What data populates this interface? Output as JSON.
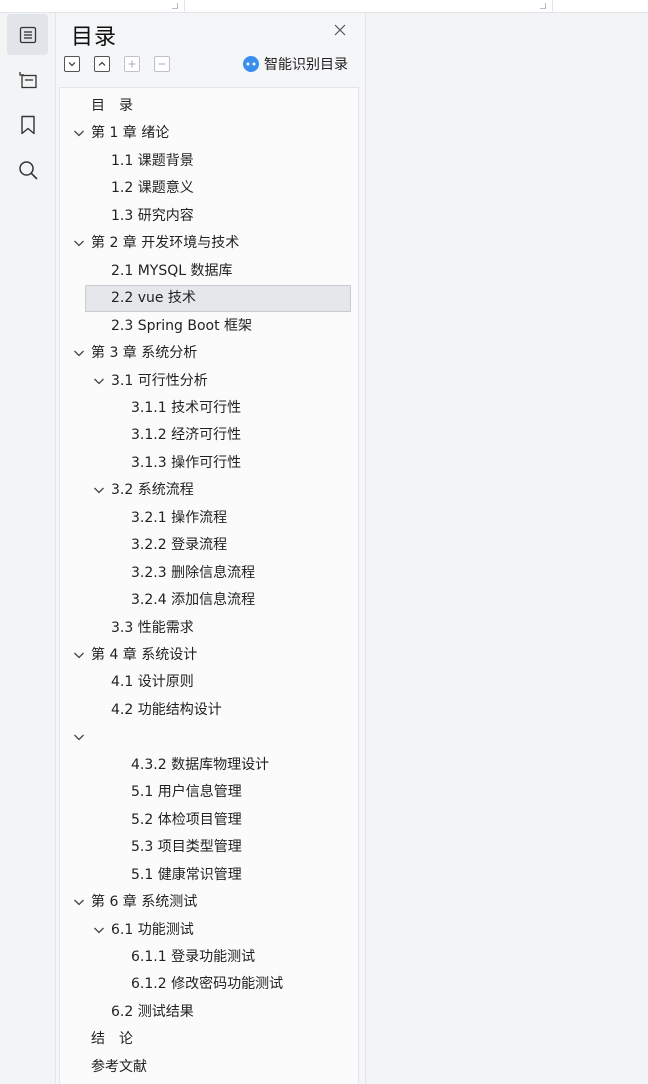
{
  "panel": {
    "title": "目录",
    "smart_button_label": "智能识别目录"
  },
  "rail": {
    "items": [
      {
        "icon": "toc-icon",
        "active": true
      },
      {
        "icon": "outline-icon",
        "active": false
      },
      {
        "icon": "bookmark-icon",
        "active": false
      },
      {
        "icon": "search-icon",
        "active": false
      }
    ]
  },
  "toc": {
    "items": [
      {
        "label": "目　录",
        "level": 0,
        "expanded": null
      },
      {
        "label": "第 1 章  绪论",
        "level": 0,
        "expanded": true
      },
      {
        "label": "1.1  课题背景",
        "level": 1,
        "expanded": null
      },
      {
        "label": "1.2  课题意义",
        "level": 1,
        "expanded": null
      },
      {
        "label": "1.3  研究内容",
        "level": 1,
        "expanded": null
      },
      {
        "label": "第 2 章  开发环境与技术",
        "level": 0,
        "expanded": true
      },
      {
        "label": "2.1 MYSQL 数据库",
        "level": 1,
        "expanded": null
      },
      {
        "label": "2.2 vue 技术",
        "level": 1,
        "expanded": null,
        "selected": true
      },
      {
        "label": "2.3 Spring Boot 框架",
        "level": 1,
        "expanded": null
      },
      {
        "label": "第 3 章  系统分析",
        "level": 0,
        "expanded": true
      },
      {
        "label": "3.1  可行性分析",
        "level": 1,
        "expanded": true
      },
      {
        "label": "3.1.1  技术可行性",
        "level": 2,
        "expanded": null
      },
      {
        "label": "3.1.2  经济可行性",
        "level": 2,
        "expanded": null
      },
      {
        "label": "3.1.3  操作可行性",
        "level": 2,
        "expanded": null
      },
      {
        "label": "3.2  系统流程",
        "level": 1,
        "expanded": true
      },
      {
        "label": "3.2.1  操作流程",
        "level": 2,
        "expanded": null
      },
      {
        "label": "3.2.2  登录流程",
        "level": 2,
        "expanded": null
      },
      {
        "label": "3.2.3  删除信息流程",
        "level": 2,
        "expanded": null
      },
      {
        "label": "3.2.4  添加信息流程",
        "level": 2,
        "expanded": null
      },
      {
        "label": "3.3  性能需求",
        "level": 1,
        "expanded": null
      },
      {
        "label": "第 4 章  系统设计",
        "level": 0,
        "expanded": true
      },
      {
        "label": "4.1  设计原则",
        "level": 1,
        "expanded": null
      },
      {
        "label": "4.2  功能结构设计",
        "level": 1,
        "expanded": null
      },
      {
        "label": "",
        "level": 0,
        "expanded": true
      },
      {
        "label": "4.3.2  数据库物理设计",
        "level": 2,
        "expanded": null
      },
      {
        "label": "5.1 用户信息管理",
        "level": 2,
        "expanded": null
      },
      {
        "label": "5.2  体检项目管理",
        "level": 2,
        "expanded": null
      },
      {
        "label": "5.3 项目类型管理",
        "level": 2,
        "expanded": null
      },
      {
        "label": "5.1 健康常识管理",
        "level": 2,
        "expanded": null
      },
      {
        "label": "第 6 章  系统测试",
        "level": 0,
        "expanded": true
      },
      {
        "label": "6.1  功能测试",
        "level": 1,
        "expanded": true
      },
      {
        "label": "6.1.1  登录功能测试",
        "level": 2,
        "expanded": null
      },
      {
        "label": "6.1.2  修改密码功能测试",
        "level": 2,
        "expanded": null
      },
      {
        "label": "6.2  测试结果",
        "level": 1,
        "expanded": null
      },
      {
        "label": "结　论",
        "level": 0,
        "expanded": null
      },
      {
        "label": "参考文献",
        "level": 0,
        "expanded": null
      }
    ]
  }
}
